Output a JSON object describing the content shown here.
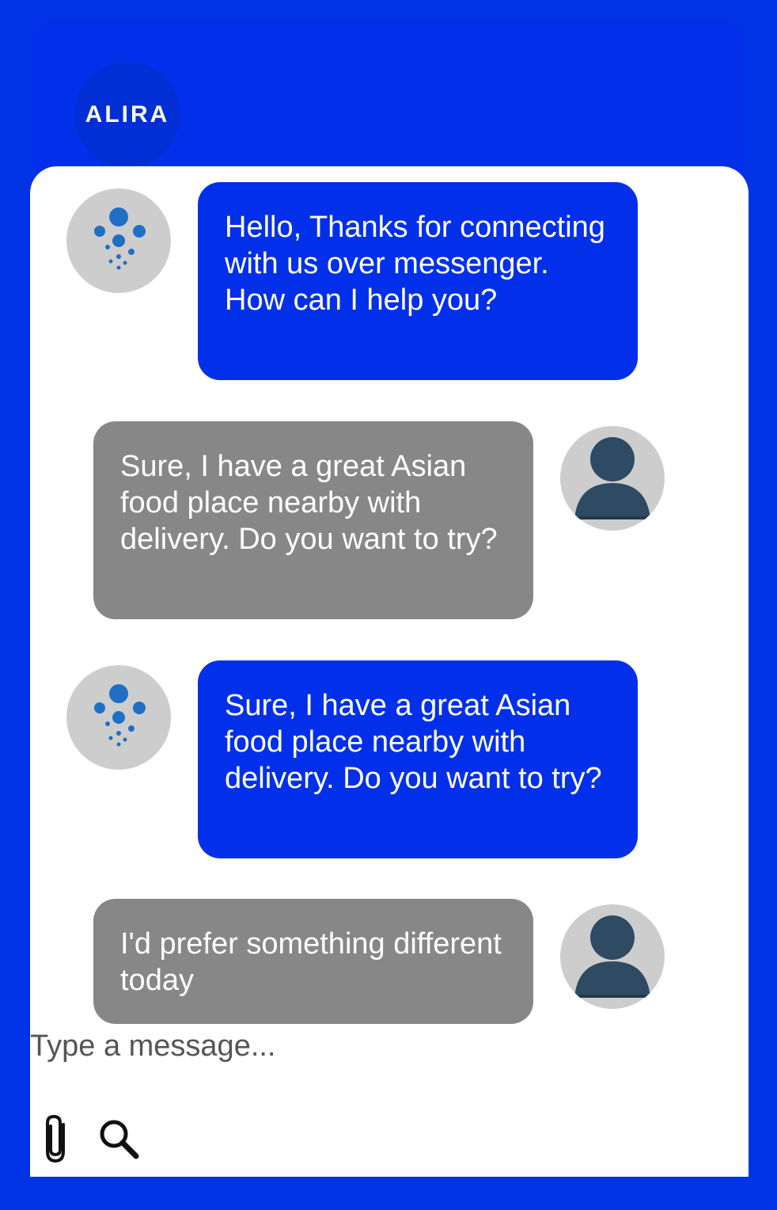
{
  "header": {
    "brand": "ALIRA"
  },
  "messages": [
    {
      "sender": "bot",
      "text": "Hello, Thanks for connecting with us over messenger. How can I help you?"
    },
    {
      "sender": "user",
      "text": "Sure, I have a great Asian food place nearby with delivery. Do you want to try?"
    },
    {
      "sender": "bot",
      "text": "Sure, I have a great Asian food place nearby with delivery. Do you want to try?"
    },
    {
      "sender": "user",
      "text": "I'd prefer something different today"
    }
  ],
  "composer": {
    "placeholder": "Type a message...",
    "icons": [
      "paperclip-icon",
      "search-icon"
    ]
  },
  "colors": {
    "background": "#0033e6",
    "bot_bubble": "#0230ea",
    "user_bubble": "#878787",
    "avatar_bg": "#cdcdcd",
    "bot_dots": "#1f6fc4",
    "user_figure": "#2f4a63"
  }
}
